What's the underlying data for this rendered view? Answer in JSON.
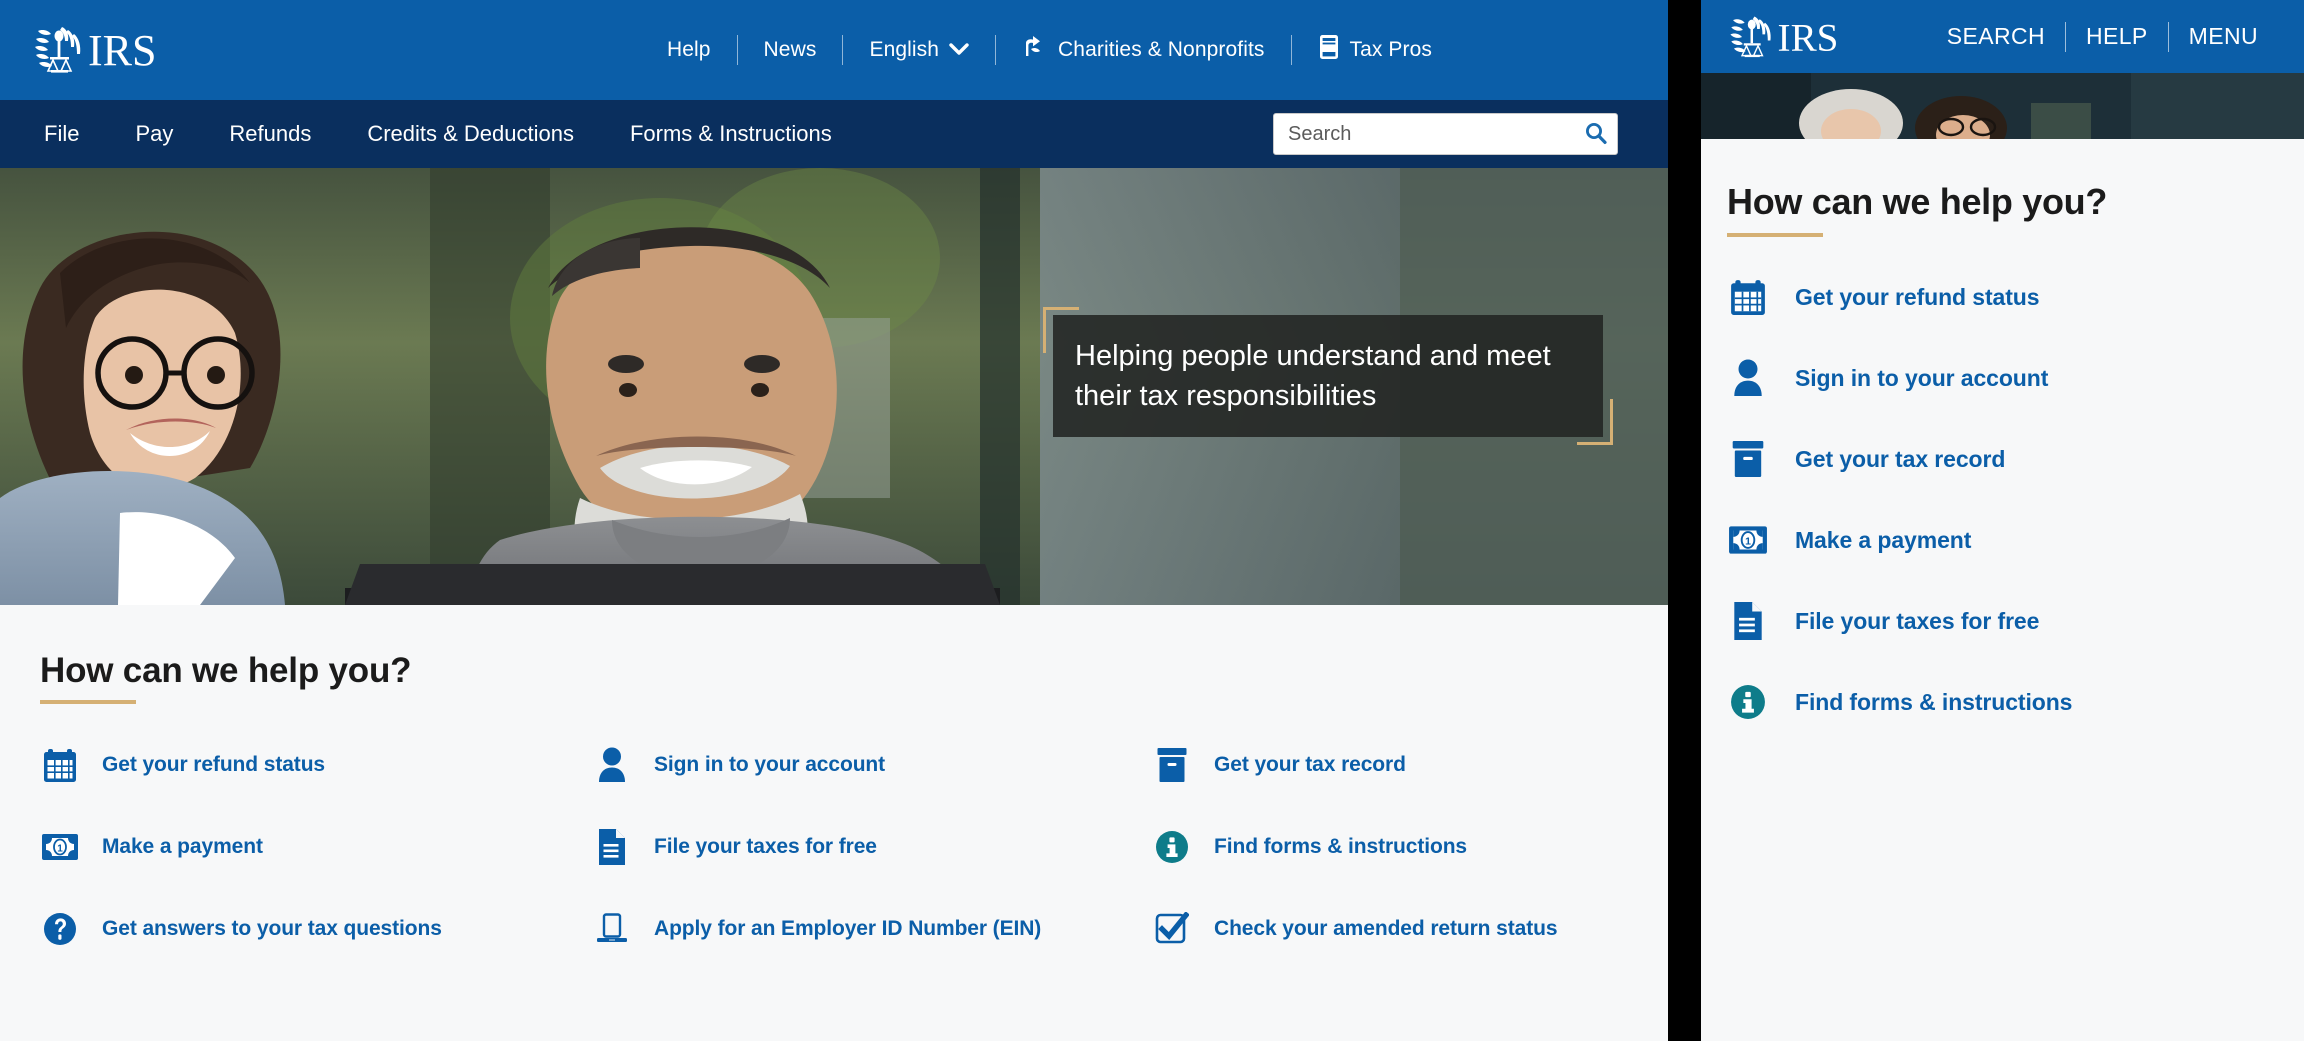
{
  "brand": {
    "name": "IRS",
    "primary_blue": "#0b5ea8",
    "dark_blue": "#0a2f5e",
    "gold": "#d5b074",
    "link_blue": "#0b5ea8",
    "teal": "#0e7c8a",
    "page_bg": "#f7f8f9"
  },
  "desktop": {
    "utility_nav": [
      {
        "label": "Help",
        "icon": ""
      },
      {
        "label": "News",
        "icon": ""
      },
      {
        "label": "English",
        "icon": "chevron-down-icon"
      },
      {
        "label": "Charities & Nonprofits",
        "icon": "charities-icon"
      },
      {
        "label": "Tax Pros",
        "icon": "tax-pros-icon"
      }
    ],
    "main_nav": [
      {
        "label": "File"
      },
      {
        "label": "Pay"
      },
      {
        "label": "Refunds"
      },
      {
        "label": "Credits & Deductions"
      },
      {
        "label": "Forms & Instructions"
      }
    ],
    "search": {
      "placeholder": "Search",
      "value": "",
      "button_icon": "search-icon"
    },
    "hero": {
      "headline": "Helping people understand and meet their tax responsibilities",
      "alt": "A young woman in a denim jacket and an older man in a grey turtleneck smiling while looking at a laptop"
    },
    "help": {
      "title": "How can we help you?",
      "links": [
        {
          "label": "Get your refund status",
          "icon": "calendar-icon",
          "color": "#0b5ea8"
        },
        {
          "label": "Sign in to your account",
          "icon": "person-icon",
          "color": "#0b5ea8"
        },
        {
          "label": "Get your tax record",
          "icon": "file-box-icon",
          "color": "#0b5ea8"
        },
        {
          "label": "Make a payment",
          "icon": "dollar-bill-icon",
          "color": "#0b5ea8"
        },
        {
          "label": "File your taxes for free",
          "icon": "document-icon",
          "color": "#0b5ea8"
        },
        {
          "label": "Find forms & instructions",
          "icon": "info-circle-icon",
          "color": "#0e7c8a"
        },
        {
          "label": "Get answers to your tax questions",
          "icon": "question-circle-icon",
          "color": "#0b5ea8"
        },
        {
          "label": "Apply for an Employer ID Number (EIN)",
          "icon": "laptop-icon",
          "color": "#0b5ea8"
        },
        {
          "label": "Check your amended return status",
          "icon": "checkbox-icon",
          "color": "#0b5ea8"
        }
      ]
    }
  },
  "mobile": {
    "header_links": [
      {
        "label": "SEARCH"
      },
      {
        "label": "HELP"
      },
      {
        "label": "MENU"
      }
    ],
    "help": {
      "title": "How can we help you?",
      "links": [
        {
          "label": "Get your refund status",
          "icon": "calendar-icon",
          "color": "#0b5ea8"
        },
        {
          "label": "Sign in to your account",
          "icon": "person-icon",
          "color": "#0b5ea8"
        },
        {
          "label": "Get your tax record",
          "icon": "file-box-icon",
          "color": "#0b5ea8"
        },
        {
          "label": "Make a payment",
          "icon": "dollar-bill-icon",
          "color": "#0b5ea8"
        },
        {
          "label": "File your taxes for free",
          "icon": "document-icon",
          "color": "#0b5ea8"
        },
        {
          "label": "Find forms & instructions",
          "icon": "info-circle-icon",
          "color": "#0e7c8a"
        }
      ]
    }
  }
}
